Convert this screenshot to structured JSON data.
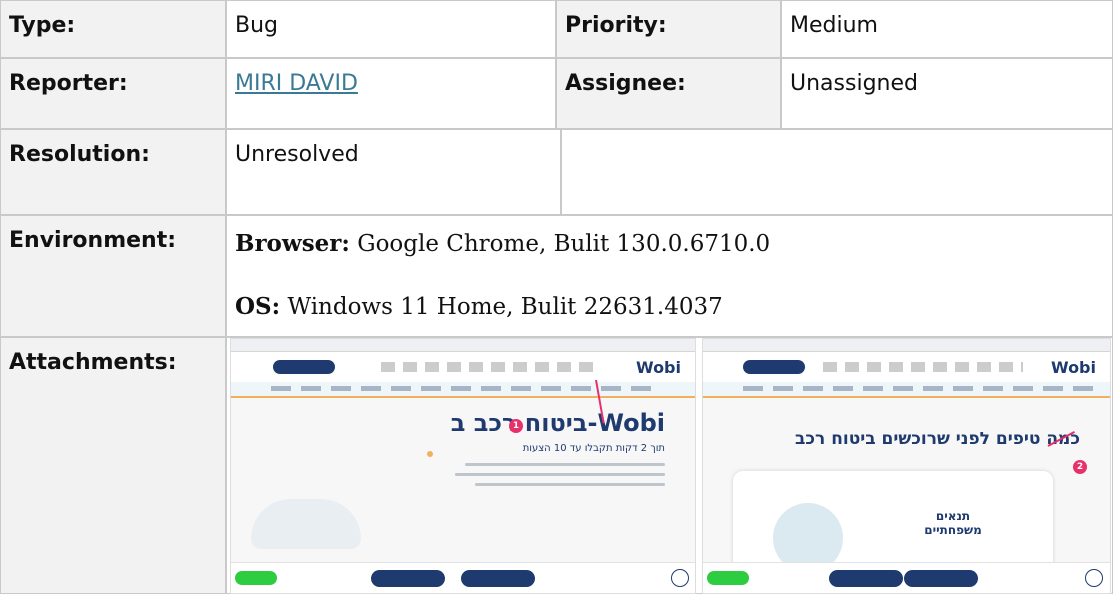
{
  "fields": {
    "type": {
      "label": "Type:",
      "value": "Bug"
    },
    "priority": {
      "label": "Priority:",
      "value": "Medium"
    },
    "reporter": {
      "label": "Reporter:",
      "value": "MIRI DAVID"
    },
    "assignee": {
      "label": "Assignee:",
      "value": "Unassigned"
    },
    "resolution": {
      "label": "Resolution:",
      "value": "Unresolved"
    },
    "environment": {
      "label": "Environment:",
      "browser_key": "Browser:",
      "browser_value": " Google Chrome, Bulit 130.0.6710.0",
      "os_key": "OS:",
      "os_value": " Windows 11 Home, Bulit 22631.4037"
    },
    "attachments": {
      "label": "Attachments:"
    }
  },
  "screenshots": {
    "left": {
      "logo": "Wobi",
      "hero_title": "ביטוח רכב ב-Wobi",
      "hero_sub": "תוך 2 דקות תקבלו עד 10 הצעות",
      "marker": "1"
    },
    "right": {
      "logo": "Wobi",
      "hero_title": "כמה טיפים לפני שרוכשים ביטוח רכב",
      "card_title": "תנאים משפחתיים",
      "marker": "2"
    }
  },
  "colors": {
    "link": "#3a7a95",
    "label_bg": "#f2f2f2",
    "brand": "#1e3a6e",
    "marker": "#e8306a"
  }
}
